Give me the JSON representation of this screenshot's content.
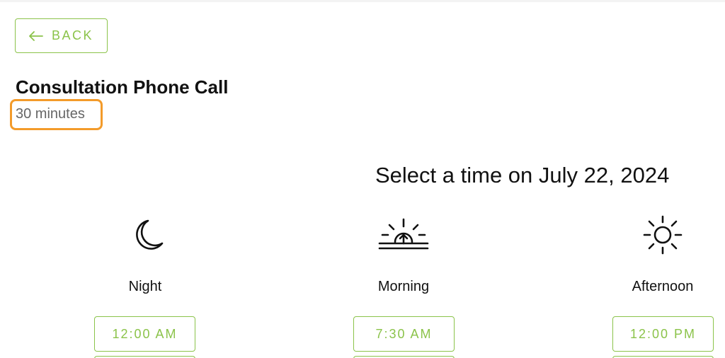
{
  "header": {
    "back_label": "BACK"
  },
  "event": {
    "title": "Consultation Phone Call",
    "duration": "30 minutes"
  },
  "schedule": {
    "heading": "Select a time on July 22, 2024",
    "columns": [
      {
        "period": "Night",
        "icon": "moon-icon",
        "first_slot": "12:00 AM"
      },
      {
        "period": "Morning",
        "icon": "sunrise-icon",
        "first_slot": "7:30 AM"
      },
      {
        "period": "Afternoon",
        "icon": "sun-icon",
        "first_slot": "12:00 PM"
      }
    ]
  },
  "colors": {
    "accent": "#8bc34a",
    "highlight": "#f39b2a",
    "text": "#111111",
    "muted": "#666666"
  }
}
